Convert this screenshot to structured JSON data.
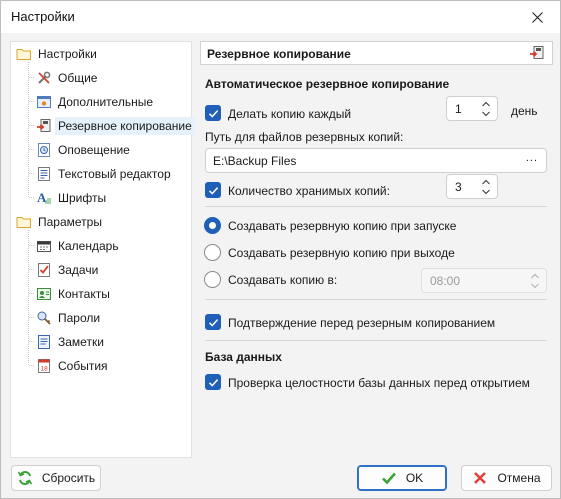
{
  "window": {
    "title": "Настройки"
  },
  "tree": {
    "groups": [
      {
        "label": "Настройки",
        "items": [
          {
            "label": "Общие",
            "icon": "wrench-icon"
          },
          {
            "label": "Дополнительные",
            "icon": "settings-window-icon"
          },
          {
            "label": "Резервное копирование",
            "icon": "backup-icon",
            "selected": true
          },
          {
            "label": "Оповещение",
            "icon": "notification-icon"
          },
          {
            "label": "Текстовый редактор",
            "icon": "text-editor-icon"
          },
          {
            "label": "Шрифты",
            "icon": "font-icon"
          }
        ]
      },
      {
        "label": "Параметры",
        "items": [
          {
            "label": "Календарь",
            "icon": "calendar-icon"
          },
          {
            "label": "Задачи",
            "icon": "tasks-icon"
          },
          {
            "label": "Контакты",
            "icon": "contacts-icon"
          },
          {
            "label": "Пароли",
            "icon": "passwords-icon"
          },
          {
            "label": "Заметки",
            "icon": "notes-icon"
          },
          {
            "label": "События",
            "icon": "events-icon"
          }
        ]
      }
    ]
  },
  "panel": {
    "header": "Резервное копирование",
    "auto_section": "Автоматическое резервное копирование",
    "make_copy": {
      "label": "Делать копию каждый",
      "checked": true,
      "value": "1",
      "unit": "день"
    },
    "path_label": "Путь для файлов резервных копий:",
    "path_value": "E:\\Backup Files",
    "browse_label": "...",
    "keep_copies": {
      "label": "Количество хранимых копий:",
      "checked": true,
      "value": "3"
    },
    "radio_start": {
      "label": "Создавать резервную копию при запуске",
      "checked": true
    },
    "radio_exit": {
      "label": "Создавать резервную копию при выходе",
      "checked": false
    },
    "radio_time": {
      "label": "Создавать копию в:",
      "checked": false,
      "value": "08:00"
    },
    "confirm": {
      "label": "Подтверждение перед резерным копированием",
      "checked": true
    },
    "db_section": "База данных",
    "integrity": {
      "label": "Проверка целостности базы данных перед открытием",
      "checked": true
    }
  },
  "buttons": {
    "reset": "Сбросить",
    "ok": "OK",
    "cancel": "Отмена"
  },
  "colors": {
    "accent": "#1f5fb8",
    "selection": "#e5f1fb",
    "ok_green": "#3aa335",
    "cancel_red": "#e0433a"
  }
}
